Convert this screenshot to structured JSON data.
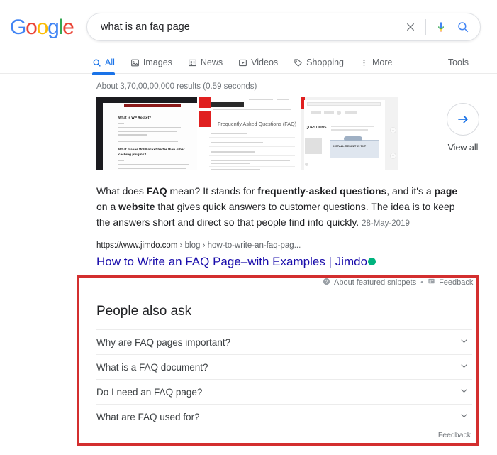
{
  "brand": {
    "logo_letters": [
      {
        "char": "G",
        "color": "#4285f4"
      },
      {
        "char": "o",
        "color": "#ea4335"
      },
      {
        "char": "o",
        "color": "#fbbc05"
      },
      {
        "char": "g",
        "color": "#4285f4"
      },
      {
        "char": "l",
        "color": "#34a853"
      },
      {
        "char": "e",
        "color": "#ea4335"
      }
    ]
  },
  "search": {
    "query": "what is an faq page",
    "placeholder": "Search",
    "clear_icon": "close-icon",
    "mic_icon": "microphone-icon",
    "search_icon": "search-icon"
  },
  "nav": {
    "tabs": [
      {
        "label": "All",
        "icon": "search-icon",
        "active": true
      },
      {
        "label": "Images",
        "icon": "image-icon",
        "active": false
      },
      {
        "label": "News",
        "icon": "news-icon",
        "active": false
      },
      {
        "label": "Videos",
        "icon": "video-icon",
        "active": false
      },
      {
        "label": "Shopping",
        "icon": "tag-icon",
        "active": false
      },
      {
        "label": "More",
        "icon": "more-vertical-icon",
        "active": false
      }
    ],
    "tools_label": "Tools"
  },
  "results": {
    "stats": "About 3,70,00,00,000 results (0.59 seconds)",
    "carousel": {
      "thumbnails": [
        {
          "alt": "faq-page-screenshot-1",
          "heading1": "What is WP Rocket?",
          "heading2": "What makes WP Rocket better than other caching plugins?"
        },
        {
          "alt": "faq-page-screenshot-2",
          "heading": "Frequently Asked Questions (FAQ)"
        },
        {
          "alt": "faq-page-screenshot-3",
          "heading": "QUESTIONS.",
          "boxlabel": "INSTALL RESULT IN TXT"
        }
      ],
      "view_all_label": "View all",
      "view_all_icon": "arrow-right-icon"
    },
    "featured_snippet": {
      "text_parts": [
        {
          "t": "What does ",
          "b": false
        },
        {
          "t": "FAQ",
          "b": true
        },
        {
          "t": " mean? It stands for ",
          "b": false
        },
        {
          "t": "frequently-asked questions",
          "b": true
        },
        {
          "t": ", and it's a ",
          "b": false
        },
        {
          "t": "page",
          "b": true
        },
        {
          "t": " on a ",
          "b": false
        },
        {
          "t": "website",
          "b": true
        },
        {
          "t": " that gives quick answers to customer questions. The idea is to keep the answers short and direct so that people find info quickly.",
          "b": false
        }
      ],
      "date": "28-May-2019",
      "url_domain": "https://www.jimdo.com",
      "url_path_1": "blog",
      "url_path_2": "how-to-write-an-faq-pag...",
      "title": "How to Write an FAQ Page–with Examples | Jimdo",
      "favicon_color": "#00b37e",
      "about_snippets_label": "About featured snippets",
      "about_snippets_icon": "question-circle-icon",
      "feedback_label": "Feedback",
      "feedback_icon": "feedback-icon",
      "separator": "•"
    },
    "people_also_ask": {
      "title": "People also ask",
      "questions": [
        {
          "text": "Why are FAQ pages important?",
          "expand_icon": "chevron-down-icon"
        },
        {
          "text": "What is a FAQ document?",
          "expand_icon": "chevron-down-icon"
        },
        {
          "text": "Do I need an FAQ page?",
          "expand_icon": "chevron-down-icon"
        },
        {
          "text": "What are FAQ used for?",
          "expand_icon": "chevron-down-icon"
        }
      ],
      "feedback_label": "Feedback"
    }
  },
  "annotation": {
    "highlight_color": "#d32f2f"
  }
}
